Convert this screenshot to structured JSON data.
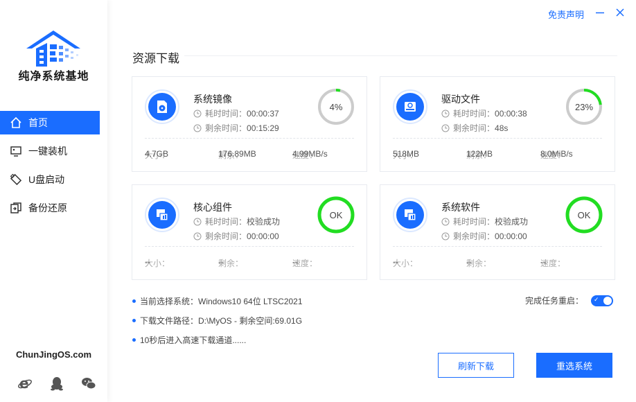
{
  "brand": {
    "name": "纯净系统基地",
    "site": "ChunJingOS.com"
  },
  "topbar": {
    "disclaimer": "免责声明",
    "minimize_icon": "minimize-icon",
    "close_icon": "close-icon"
  },
  "sidebar": {
    "items": [
      {
        "label": "首页",
        "icon": "home-icon",
        "active": true
      },
      {
        "label": "一键装机",
        "icon": "install-icon",
        "active": false
      },
      {
        "label": "U盘启动",
        "icon": "usb-icon",
        "active": false
      },
      {
        "label": "备份还原",
        "icon": "backup-icon",
        "active": false
      }
    ],
    "socials": [
      "ie-icon",
      "qq-icon",
      "wechat-icon"
    ]
  },
  "main": {
    "title": "资源下载",
    "labels": {
      "elapsed": "耗时时间：",
      "remaining": "剩余时间：",
      "size": "大小：",
      "left": "剩余：",
      "speed": "速度："
    },
    "cards": [
      {
        "name": "系统镜像",
        "icon": "disc-icon",
        "elapsed": "00:00:37",
        "remaining": "00:15:29",
        "progress_text": "4%",
        "progress": 0.04,
        "done": false,
        "size": "4.7GB",
        "left": "176.89MB",
        "speed": "4.99MB/s"
      },
      {
        "name": "驱动文件",
        "icon": "drive-icon",
        "elapsed": "00:00:38",
        "remaining": "48s",
        "progress_text": "23%",
        "progress": 0.23,
        "done": false,
        "size": "518MB",
        "left": "122MB",
        "speed": "8.0MiB/s"
      },
      {
        "name": "核心组件",
        "icon": "component-icon",
        "elapsed": "校验成功",
        "remaining": "00:00:00",
        "progress_text": "OK",
        "progress": 1,
        "done": true,
        "size": "--",
        "left": "--",
        "speed": "--"
      },
      {
        "name": "系统软件",
        "icon": "software-icon",
        "elapsed": "校验成功",
        "remaining": "00:00:00",
        "progress_text": "OK",
        "progress": 1,
        "done": true,
        "size": "--",
        "left": "--",
        "speed": "--"
      }
    ],
    "info": {
      "system": "当前选择系统：Windows10 64位 LTSC2021",
      "path": "下载文件路径：D:\\MyOS - 剩余空间:69.01G",
      "tip": "10秒后进入高速下载通道......"
    },
    "restart": {
      "label": "完成任务重启：",
      "on": true
    },
    "buttons": {
      "refresh": "刷新下载",
      "reselect": "重选系统"
    }
  },
  "colors": {
    "accent": "#1a6dff",
    "ok": "#22dd22",
    "ring_track": "#cccccc"
  }
}
